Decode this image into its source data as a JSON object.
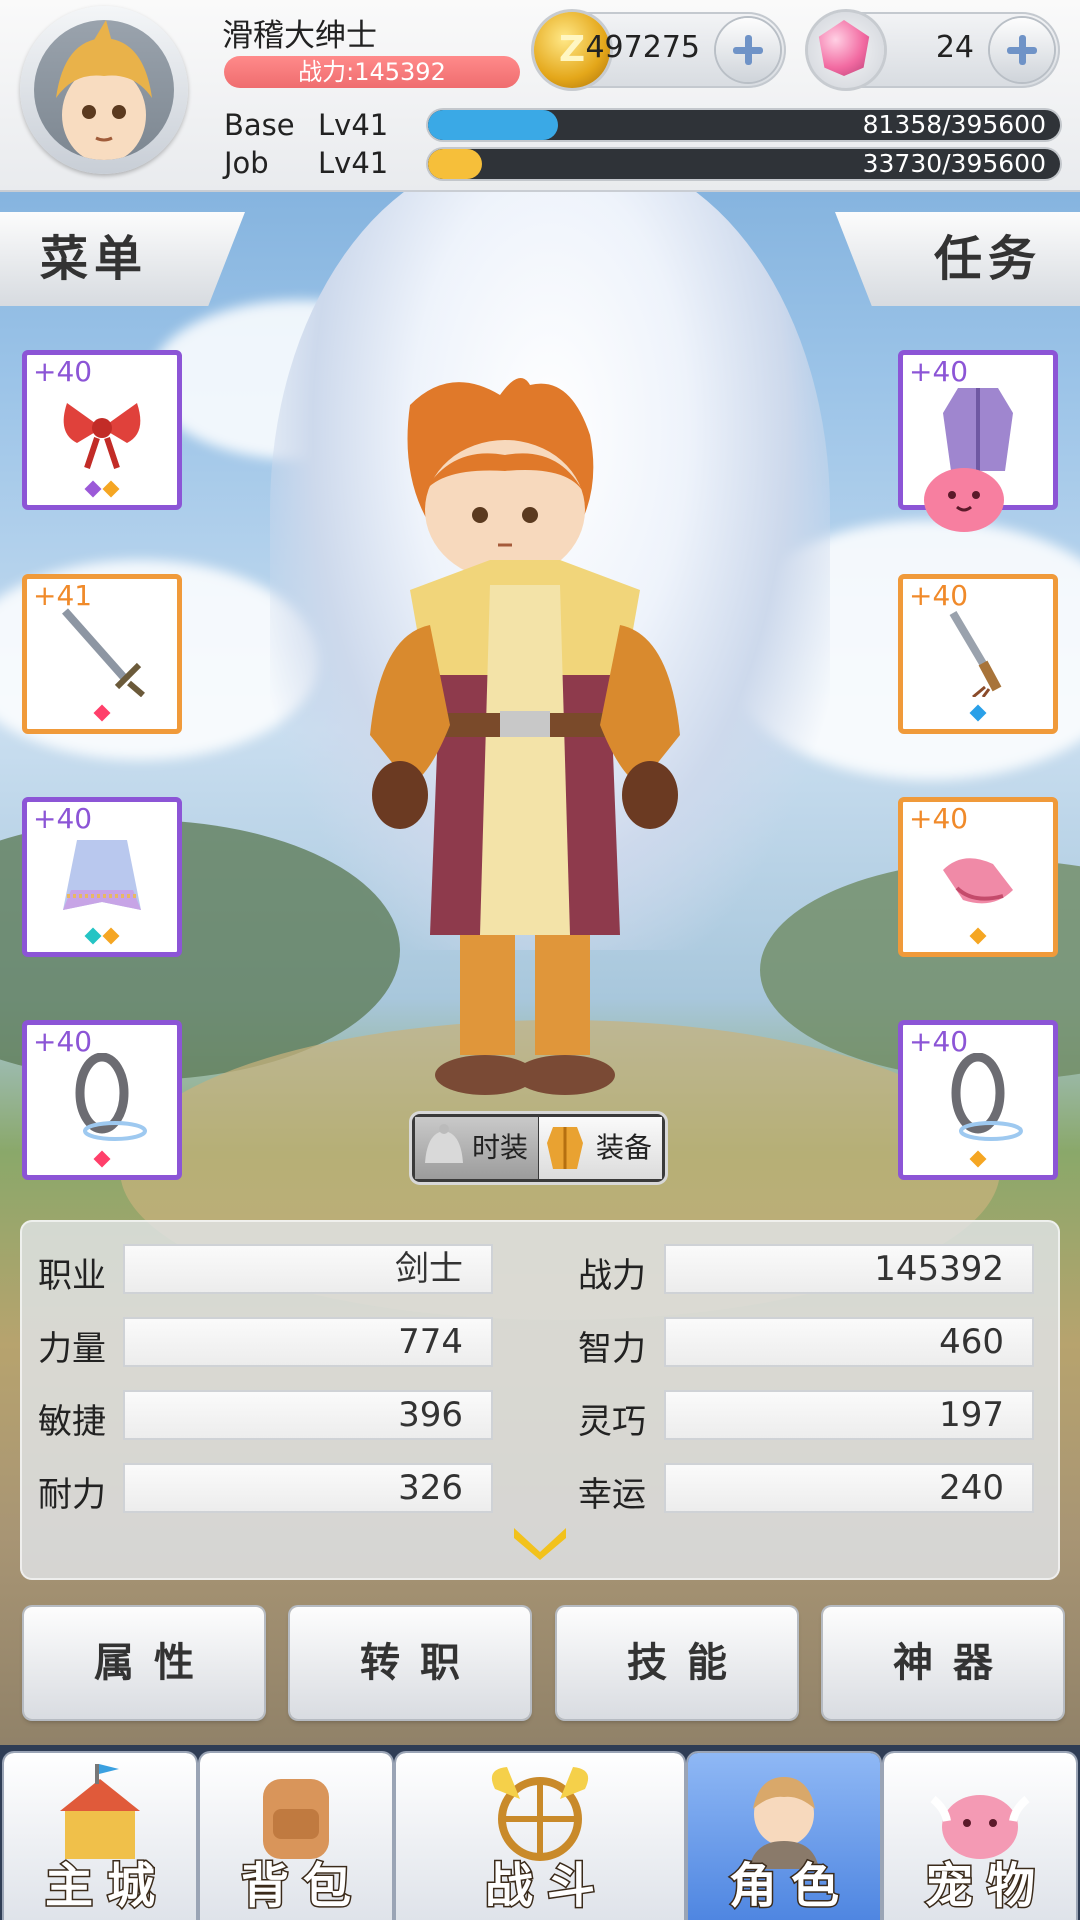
{
  "player": {
    "name": "滑稽大绅士",
    "power_label": "战力:145392",
    "base_label": "Base",
    "base_level": "Lv41",
    "base_exp": "81358/395600",
    "base_exp_fraction": 0.206,
    "job_label": "Job",
    "job_level": "Lv41",
    "job_exp": "33730/395600",
    "job_exp_fraction": 0.085
  },
  "currency": {
    "zeny": "497275",
    "gems": "24"
  },
  "tabs": {
    "menu": "菜单",
    "quest": "任务"
  },
  "equipment": {
    "left": [
      {
        "level": "+40",
        "icon": "red-bow-headgear-icon",
        "gems": [
          "#9b59d8",
          "#f5a623"
        ],
        "rarity": "purple"
      },
      {
        "level": "+41",
        "icon": "sword-icon",
        "gems": [
          "#ff3f6a"
        ],
        "rarity": "orange"
      },
      {
        "level": "+40",
        "icon": "cape-icon",
        "gems": [
          "#25c4c4",
          "#f5a623"
        ],
        "rarity": "purple"
      },
      {
        "level": "+40",
        "icon": "spiked-ring-icon",
        "gems": [
          "#ff3f6a"
        ],
        "rarity": "purple"
      }
    ],
    "right": [
      {
        "level": "+40",
        "icon": "purple-armor-icon",
        "gems": [],
        "rarity": "purple"
      },
      {
        "level": "+40",
        "icon": "dagger-icon",
        "gems": [
          "#2aa0e8"
        ],
        "rarity": "orange"
      },
      {
        "level": "+40",
        "icon": "pink-shoes-icon",
        "gems": [
          "#f5a623"
        ],
        "rarity": "orange"
      },
      {
        "level": "+40",
        "icon": "spiked-ring-icon",
        "gems": [
          "#f5a623"
        ],
        "rarity": "purple"
      }
    ]
  },
  "toggle": {
    "fashion": "时装",
    "equipment": "装备"
  },
  "stats": {
    "left": [
      {
        "label": "职业",
        "value": "剑士"
      },
      {
        "label": "力量",
        "value": "774"
      },
      {
        "label": "敏捷",
        "value": "396"
      },
      {
        "label": "耐力",
        "value": "326"
      }
    ],
    "right": [
      {
        "label": "战力",
        "value": "145392"
      },
      {
        "label": "智力",
        "value": "460"
      },
      {
        "label": "灵巧",
        "value": "197"
      },
      {
        "label": "幸运",
        "value": "240"
      }
    ]
  },
  "actions": {
    "attributes": "属性",
    "job_change": "转职",
    "skills": "技能",
    "artifact": "神器"
  },
  "nav": [
    {
      "label": "主城",
      "icon": "castle-icon",
      "active": false
    },
    {
      "label": "背包",
      "icon": "backpack-icon",
      "active": false
    },
    {
      "label": "战斗",
      "icon": "battle-wheel-icon",
      "active": false
    },
    {
      "label": "角色",
      "icon": "character-icon",
      "active": true
    },
    {
      "label": "宠物",
      "icon": "poring-pet-icon",
      "active": false
    }
  ],
  "colors": {
    "base_bar": "#3aa9e6",
    "job_bar": "#f6bf3a",
    "power_pill": "#f07073",
    "purple_frame": "#8c55d6",
    "orange_frame": "#f09a3a",
    "nav_active": "#5a8fe6"
  }
}
